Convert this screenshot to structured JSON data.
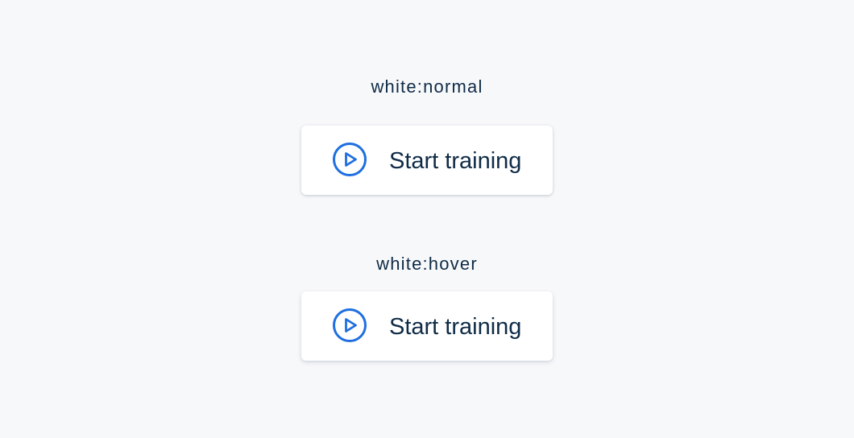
{
  "states": {
    "normal": {
      "label": "white:normal",
      "button_label": "Start training",
      "icon": "play-circle-icon"
    },
    "hover": {
      "label": "white:hover",
      "button_label": "Start training",
      "icon": "play-circle-icon"
    }
  },
  "colors": {
    "background": "#f7f8fa",
    "button_background": "#ffffff",
    "text": "#0f2b46",
    "icon_accent": "#1f6fe0"
  }
}
